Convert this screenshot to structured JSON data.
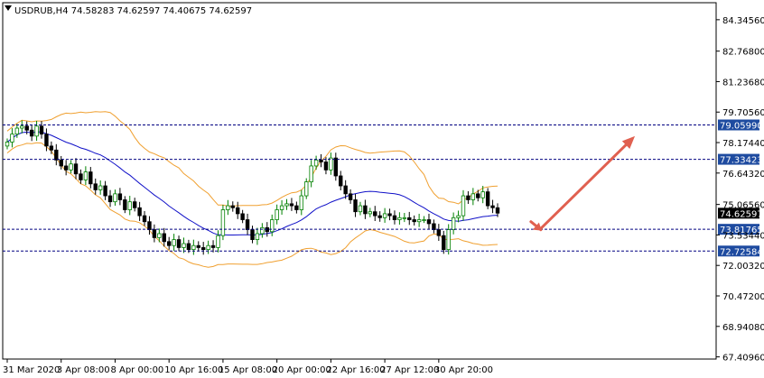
{
  "header": {
    "symbol_line": "USDRUB,H4  74.58283 74.62597 74.40675 74.62597"
  },
  "colors": {
    "background": "#ffffff",
    "candle_up_border": "#008000",
    "candle_up_body": "#ffffff",
    "candle_down": "#000000",
    "moving_average": "#1010c8",
    "bollinger_bands": "#f0a030",
    "level_lines": "#000080",
    "level_label_bg": "#1e4ba0",
    "current_price_bg": "#000000",
    "arrow": "#e06050"
  },
  "chart_data": {
    "type": "candlestick",
    "symbol": "USDRUB",
    "timeframe": "H4",
    "ylim": [
      67.3,
      85.2
    ],
    "y_ticks": [
      "84.34560",
      "82.76800",
      "81.23680",
      "79.70560",
      "78.17440",
      "76.64320",
      "75.06560",
      "73.53440",
      "72.00320",
      "70.47200",
      "68.94080",
      "67.40960"
    ],
    "x_ticks": [
      {
        "label": "31 Mar 2020",
        "index": 0
      },
      {
        "label": "3 Apr 08:00",
        "index": 11
      },
      {
        "label": "8 Apr 00:00",
        "index": 22
      },
      {
        "label": "10 Apr 16:00",
        "index": 33
      },
      {
        "label": "15 Apr 08:00",
        "index": 44
      },
      {
        "label": "20 Apr 00:00",
        "index": 55
      },
      {
        "label": "22 Apr 16:00",
        "index": 66
      },
      {
        "label": "27 Apr 12:00",
        "index": 77
      },
      {
        "label": "30 Apr 20:00",
        "index": 88
      }
    ],
    "current_price": "74.62597",
    "levels": [
      {
        "value": 79.0599,
        "label": "79.05990"
      },
      {
        "value": 77.33423,
        "label": "77.33423"
      },
      {
        "value": 73.81765,
        "label": "73.81765"
      },
      {
        "value": 72.72584,
        "label": "72.72584"
      }
    ],
    "closes": [
      78.2,
      78.6,
      78.9,
      79.0,
      78.8,
      78.5,
      79.0,
      78.6,
      78.0,
      77.8,
      77.3,
      77.0,
      76.8,
      77.1,
      76.6,
      76.3,
      76.7,
      76.1,
      75.8,
      76.0,
      75.5,
      75.2,
      75.6,
      75.3,
      74.8,
      75.2,
      74.9,
      74.5,
      74.2,
      73.8,
      73.4,
      73.6,
      73.2,
      73.0,
      73.3,
      72.9,
      73.1,
      72.8,
      73.0,
      72.9,
      72.8,
      73.0,
      72.9,
      73.5,
      74.8,
      75.0,
      74.9,
      74.6,
      74.3,
      73.8,
      73.3,
      73.6,
      73.9,
      73.7,
      74.3,
      74.8,
      75.0,
      75.1,
      75.0,
      74.8,
      75.5,
      76.2,
      77.0,
      77.3,
      77.2,
      76.8,
      77.4,
      76.5,
      76.0,
      75.6,
      75.3,
      74.7,
      75.0,
      74.6,
      74.7,
      74.5,
      74.4,
      74.6,
      74.5,
      74.3,
      74.4,
      74.4,
      74.3,
      74.2,
      74.3,
      74.3,
      74.1,
      73.8,
      73.5,
      72.8,
      73.8,
      74.4,
      74.5,
      75.5,
      75.3,
      75.6,
      75.4,
      75.7,
      75.0,
      74.9,
      74.63
    ],
    "arrow": {
      "from_index": 109,
      "from_value": 73.9,
      "to_index": 128,
      "to_value": 78.5
    },
    "down_arrow_tip": {
      "index": 109,
      "value": 73.75
    }
  }
}
